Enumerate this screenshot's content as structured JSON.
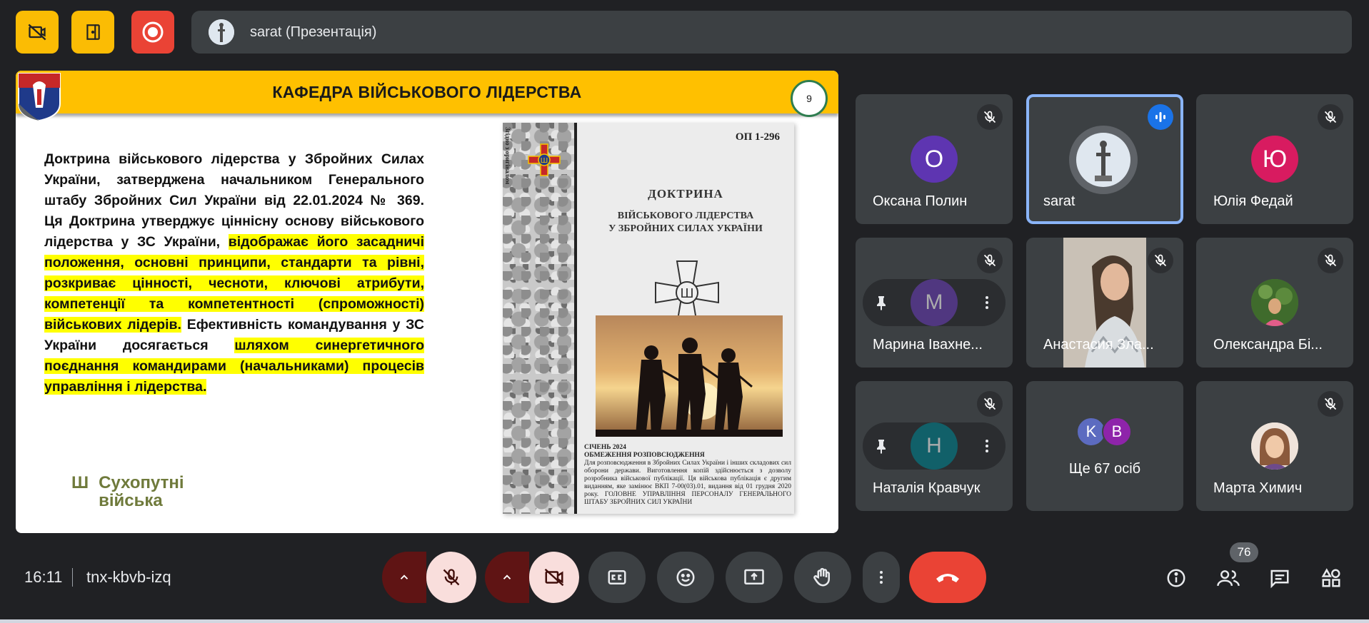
{
  "top": {
    "presenter_name": "sarat (Презентація)"
  },
  "slide": {
    "title": "КАФЕДРА ВІЙСЬКОВОГО ЛІДЕРСТВА",
    "page_number": "9",
    "para1": "Доктрина військового лідерства у Збройних Силах України, затверджена начальником Генерального штабу Збройних Сил України від 22.01.2024 № 369.",
    "para2_start": "Ця Доктрина утверджує ціннісну основу військового лідерства у ЗС України, ",
    "para2_highlight": "відображає його засадничі положення, основні принципи, стандарти та рівні, розкриває цінності, чесноти, ключові атрибути, компетенції та компетентності (спроможності) військових лідерів.",
    "para3_start": " Ефективність командування у ЗС України досягається ",
    "para3_highlight": "шляхом синергетичного поєднання командирами (начальниками) процесів управління і лідерства.",
    "logo_line1": "Сухопутні",
    "logo_line2": "війська",
    "book": {
      "code": "ОП 1-296",
      "vertical": "Згідно з оригіналом",
      "title1": "ДОКТРИНА",
      "title2": "ВІЙСЬКОВОГО ЛІДЕРСТВА",
      "title3": "У ЗБРОЙНИХ СИЛАХ УКРАЇНИ",
      "date": "СІЧЕНЬ 2024",
      "restriction": "ОБМЕЖЕННЯ РОЗПОВСЮДЖЕННЯ",
      "small_text": "Для розповсюдження в Збройних Силах України і інших складових сил оборони держави. Виготовлення копій здійснюється з дозволу розробника військової публікації. Ця військова публікація є другим виданням, яке замінює ВКП 7-00(03).01, видання від 01 грудня 2020 року. ГОЛОВНЕ УПРАВЛІННЯ ПЕРСОНАЛУ ГЕНЕРАЛЬНОГО ШТАБУ ЗБРОЙНИХ СИЛ УКРАЇНИ"
    }
  },
  "participants": [
    {
      "name": "Оксана Полин",
      "initial": "О",
      "color": "#5e35b1"
    },
    {
      "name": "sarat"
    },
    {
      "name": "Юлія Федай",
      "initial": "Ю",
      "color": "#d81b60"
    },
    {
      "name": "Марина Івахне...",
      "initial": "M",
      "color": "#6a3fb5"
    },
    {
      "name": "Анастасия Зла..."
    },
    {
      "name": "Олександра Бі..."
    },
    {
      "name": "Наталія Кравчук",
      "initial": "H",
      "color": "#00838f"
    },
    {
      "name": "Марта Химич"
    }
  ],
  "more": {
    "label": "Ще 67 осіб",
    "initials": [
      "K",
      "B"
    ],
    "colors": [
      "#5c6bc0",
      "#8e24aa"
    ]
  },
  "bottom": {
    "time": "16:11",
    "meeting_code": "tnx-kbvb-izq",
    "participant_count": "76"
  }
}
